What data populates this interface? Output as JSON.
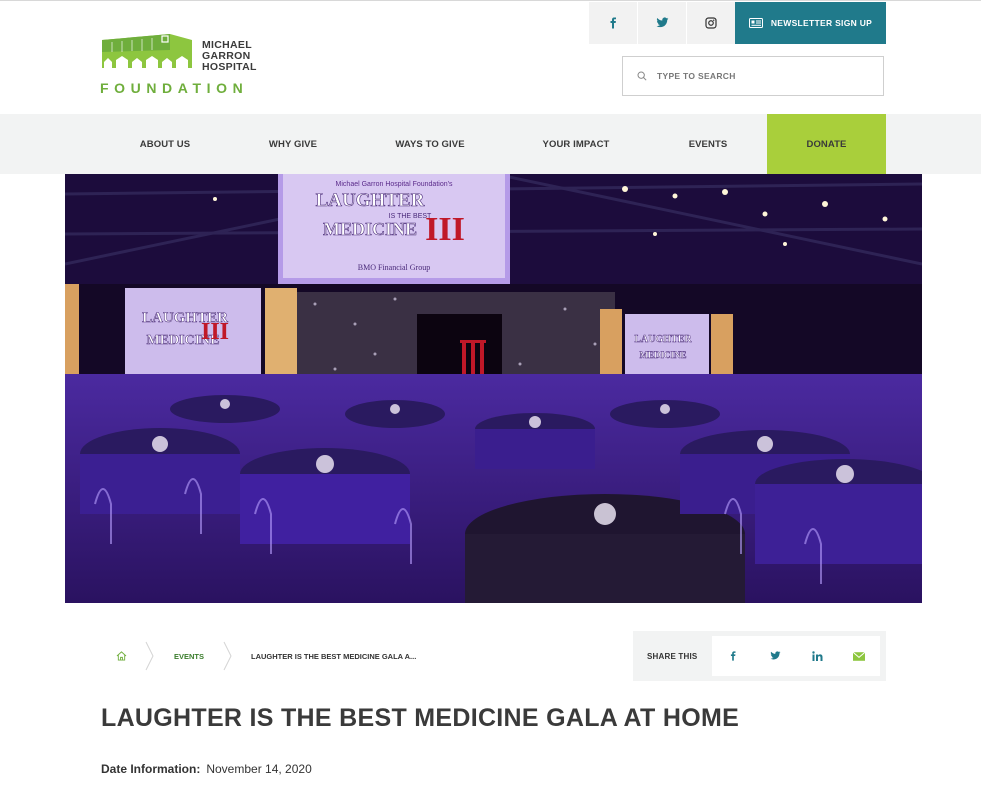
{
  "logo": {
    "line1": "MICHAEL",
    "line2": "GARRON",
    "line3": "HOSPITAL",
    "foundation": "FOUNDATION",
    "brand_green": "#6fae3c"
  },
  "header": {
    "social": [
      {
        "name": "facebook-icon"
      },
      {
        "name": "twitter-icon"
      },
      {
        "name": "instagram-icon"
      }
    ],
    "newsletter_label": "NEWSLETTER SIGN UP",
    "newsletter_color": "#207a8b",
    "search_placeholder": "TYPE TO SEARCH"
  },
  "nav": {
    "items": [
      {
        "label": "ABOUT US"
      },
      {
        "label": "WHY GIVE"
      },
      {
        "label": "WAYS TO GIVE"
      },
      {
        "label": "YOUR IMPACT"
      },
      {
        "label": "EVENTS"
      },
      {
        "label": "DONATE"
      }
    ],
    "donate_color": "#a9cf3b"
  },
  "hero": {
    "screen_line1": "Michael Garron Hospital Foundation's",
    "screen_line2": "LAUGHTER",
    "screen_line3": "IS THE BEST",
    "screen_line4": "MEDICINE",
    "numeral": "III",
    "sponsor": "BMO Financial Group"
  },
  "breadcrumb": {
    "home_icon": "home-icon",
    "events": "EVENTS",
    "current": "LAUGHTER IS THE BEST MEDICINE GALA A..."
  },
  "share": {
    "label": "SHARE THIS",
    "buttons": [
      "facebook-icon",
      "twitter-icon",
      "linkedin-icon",
      "email-icon"
    ],
    "icon_color": "#207a8b"
  },
  "article": {
    "title": "LAUGHTER IS THE BEST MEDICINE GALA AT HOME",
    "date_label": "Date Information:",
    "date_value": "November 14, 2020"
  }
}
